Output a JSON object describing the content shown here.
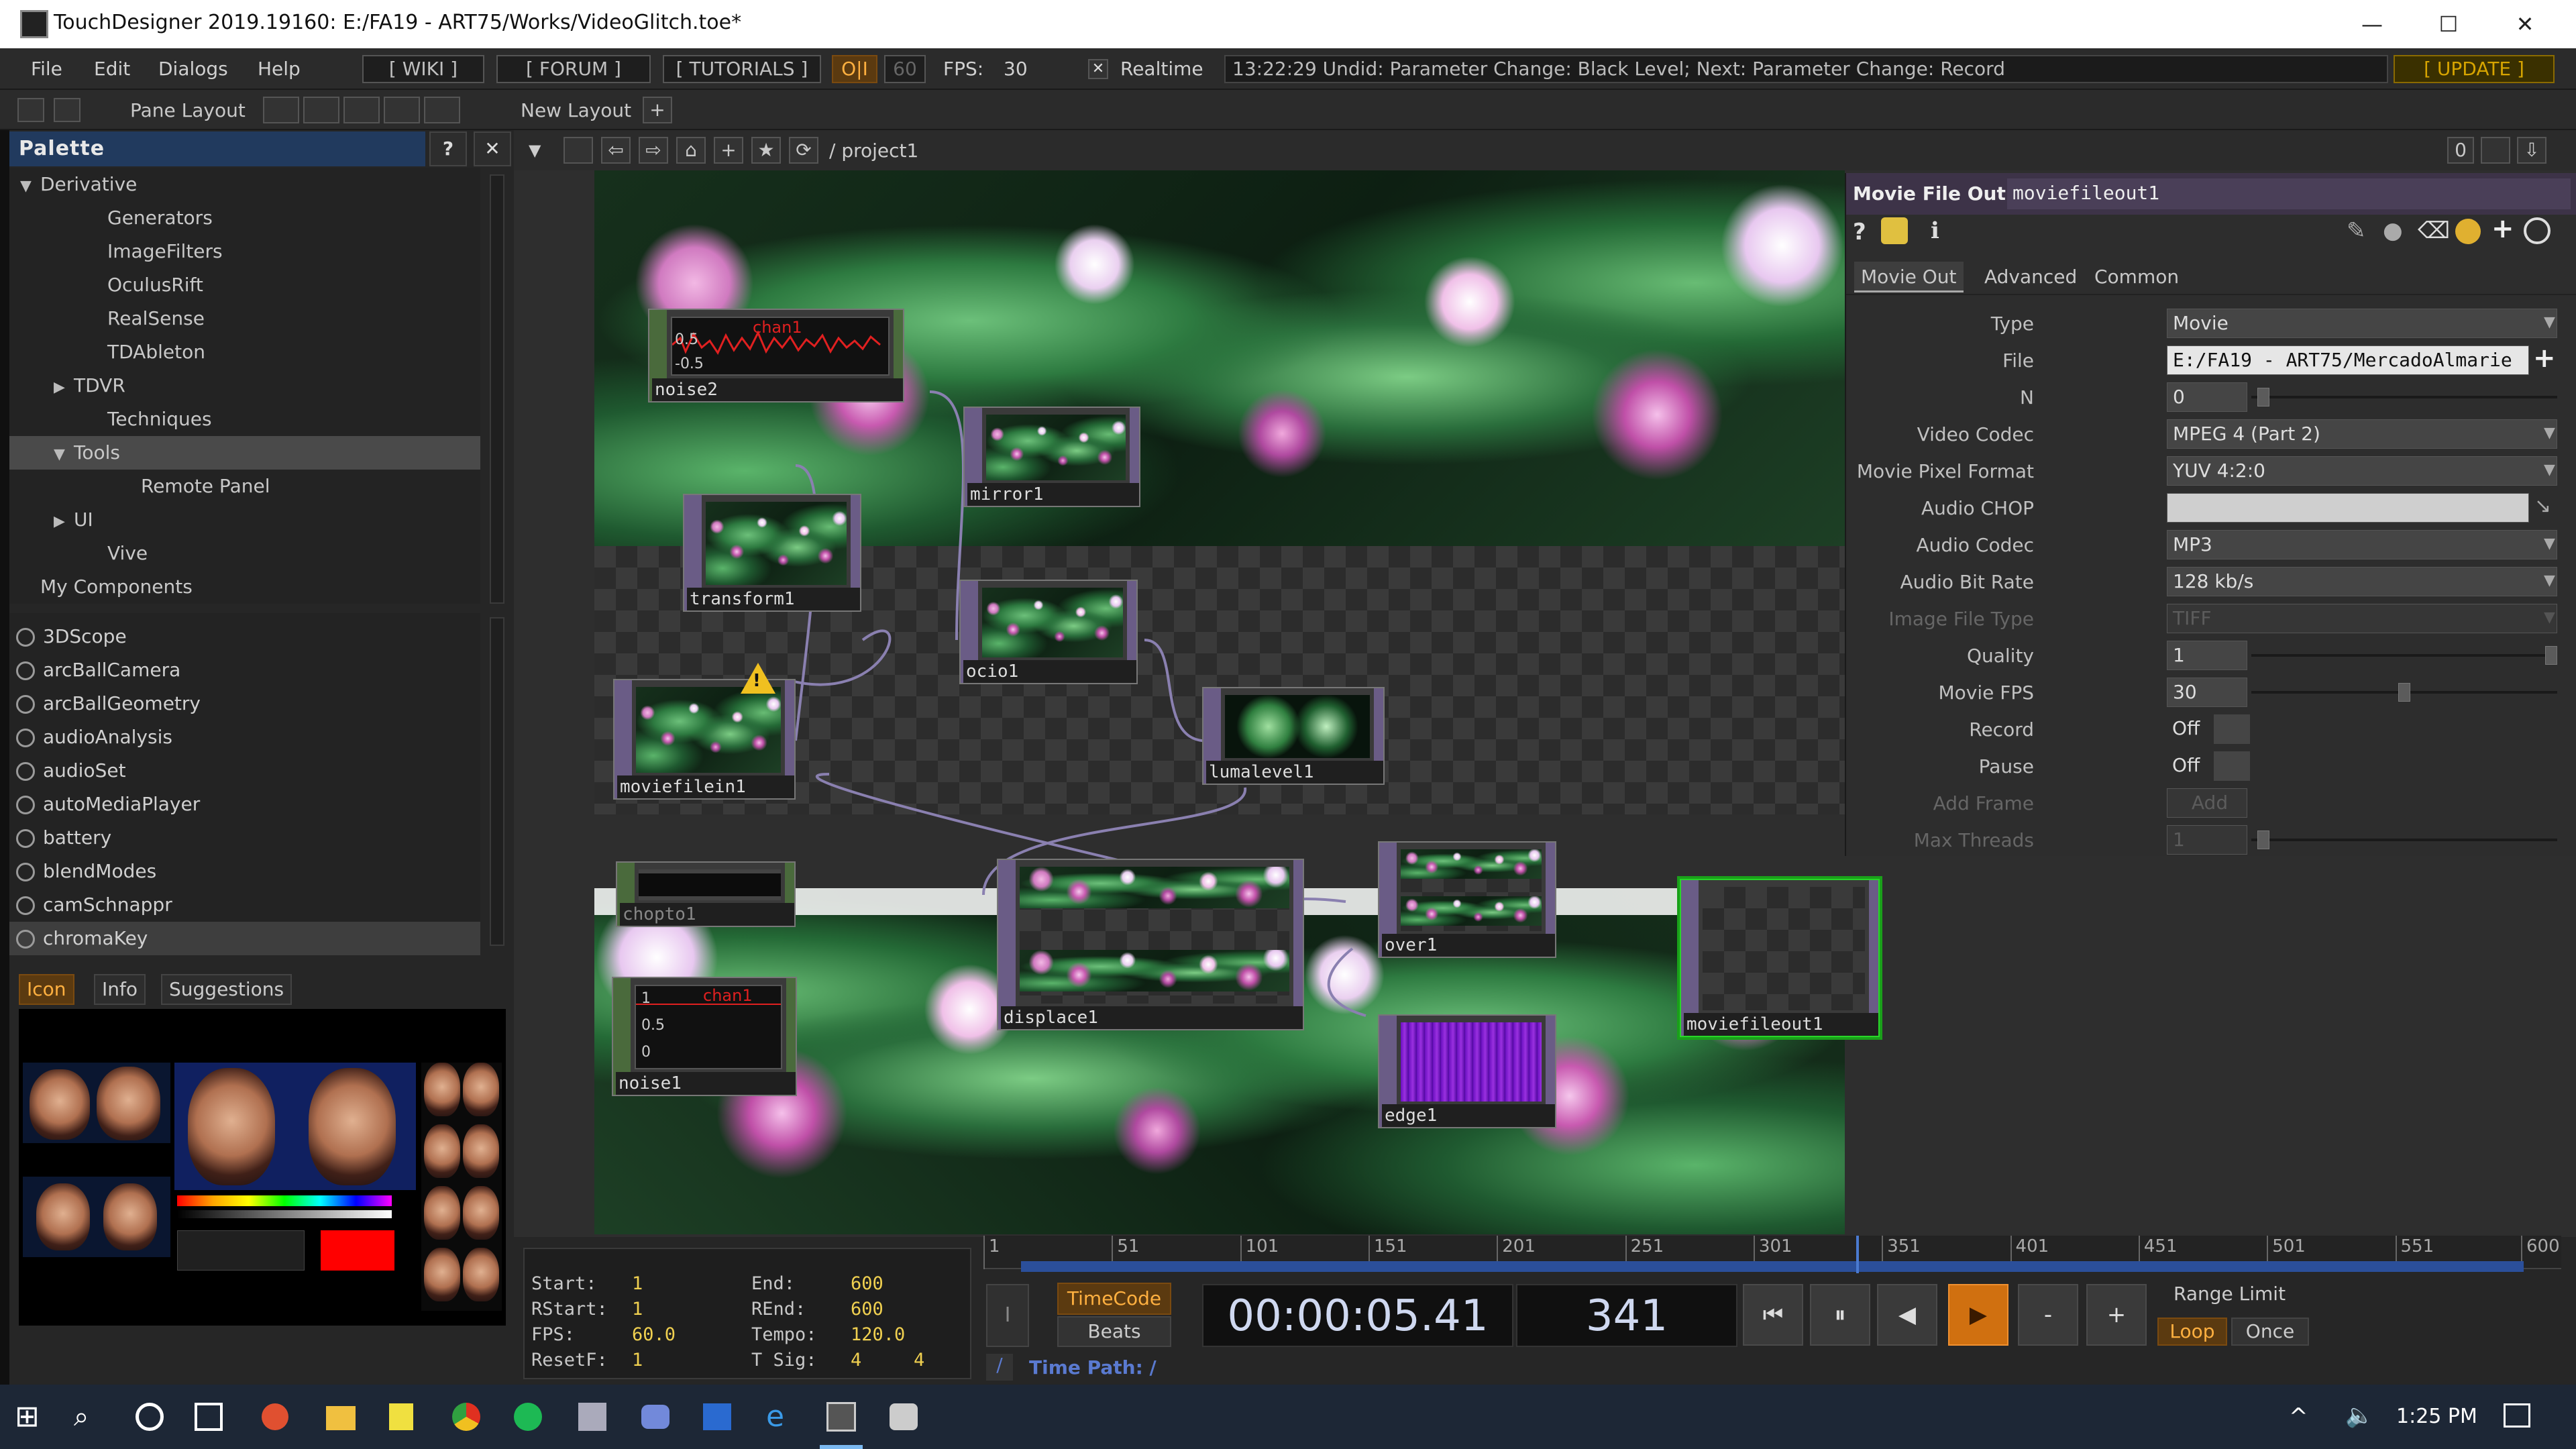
{
  "window": {
    "title": "TouchDesigner 2019.19160: E:/FA19 - ART75/Works/VideoGlitch.toe*",
    "minimize": "—",
    "maximize": "☐",
    "close": "✕"
  },
  "menubar": {
    "items": [
      "File",
      "Edit",
      "Dialogs",
      "Help"
    ],
    "wiki": "[ WIKI ]",
    "forum": "[ FORUM ]",
    "tutorials": "[ TUTORIALS ]",
    "oi": "O|I",
    "fps_target": "60",
    "fps_label": "FPS:",
    "fps_value": "30",
    "realtime": "Realtime",
    "status_message": "13:22:29 Undid: Parameter Change: Black Level; Next: Parameter Change: Record",
    "update": "[ UPDATE ]"
  },
  "toolbar": {
    "pane_layout": "Pane Layout",
    "new_layout": "New Layout",
    "add": "+"
  },
  "palette": {
    "title": "Palette",
    "help": "?",
    "close": "✕",
    "tree": [
      {
        "label": "Derivative",
        "level": 0,
        "arrow": "▼"
      },
      {
        "label": "Generators",
        "level": 2,
        "arrow": ""
      },
      {
        "label": "ImageFilters",
        "level": 2,
        "arrow": ""
      },
      {
        "label": "OculusRift",
        "level": 2,
        "arrow": ""
      },
      {
        "label": "RealSense",
        "level": 2,
        "arrow": ""
      },
      {
        "label": "TDAbleton",
        "level": 2,
        "arrow": ""
      },
      {
        "label": "TDVR",
        "level": 1,
        "arrow": "▶"
      },
      {
        "label": "Techniques",
        "level": 2,
        "arrow": ""
      },
      {
        "label": "Tools",
        "level": 1,
        "arrow": "▼",
        "selected": true
      },
      {
        "label": "Remote Panel",
        "level": 3,
        "arrow": ""
      },
      {
        "label": "UI",
        "level": 1,
        "arrow": "▶"
      },
      {
        "label": "Vive",
        "level": 2,
        "arrow": ""
      },
      {
        "label": "My Components",
        "level": 0,
        "arrow": ""
      }
    ],
    "components": [
      "3DScope",
      "arcBallCamera",
      "arcBallGeometry",
      "audioAnalysis",
      "audioSet",
      "autoMediaPlayer",
      "battery",
      "blendModes",
      "camSchnappr",
      "chromaKey"
    ],
    "selected_component": "chromaKey",
    "tabs": [
      "Icon",
      "Info",
      "Suggestions"
    ],
    "active_tab": "Icon"
  },
  "network": {
    "path": "/ project1",
    "right_counter": "0",
    "nodes": [
      {
        "name": "noise2",
        "chan_label": "chan1",
        "y_hi": "0.5",
        "y_lo": "-0.5"
      },
      {
        "name": "mirror1"
      },
      {
        "name": "transform1"
      },
      {
        "name": "ocio1"
      },
      {
        "name": "moviefilein1",
        "warning": "!"
      },
      {
        "name": "lumalevel1"
      },
      {
        "name": "chopto1"
      },
      {
        "name": "displace1"
      },
      {
        "name": "over1"
      },
      {
        "name": "edge1"
      },
      {
        "name": "moviefileout1"
      },
      {
        "name": "noise1",
        "chan_label": "chan1",
        "y_1": "1",
        "y_05": "0.5",
        "y_0": "0"
      }
    ]
  },
  "params": {
    "op_type": "Movie File Out",
    "op_name": "moviefileout1",
    "help": "?",
    "info": "i",
    "tabs": [
      "Movie Out",
      "Advanced",
      "Common"
    ],
    "active_tab": "Movie Out",
    "rows": [
      {
        "label": "Type",
        "value": "Movie",
        "kind": "menu",
        "dim": false
      },
      {
        "label": "File",
        "value": "E:/FA19 - ART75/MercadoAlmarie",
        "kind": "file",
        "dim": false
      },
      {
        "label": "N",
        "value": "0",
        "kind": "slider",
        "dim": false
      },
      {
        "label": "Video Codec",
        "value": "MPEG 4 (Part 2)",
        "kind": "menu",
        "dim": false
      },
      {
        "label": "Movie Pixel Format",
        "value": "YUV 4:2:0",
        "kind": "menu",
        "dim": false
      },
      {
        "label": "Audio CHOP",
        "value": "",
        "kind": "ref",
        "dim": false
      },
      {
        "label": "Audio Codec",
        "value": "MP3",
        "kind": "menu",
        "dim": false
      },
      {
        "label": "Audio Bit Rate",
        "value": "128 kb/s",
        "kind": "menu",
        "dim": false
      },
      {
        "label": "Image File Type",
        "value": "TIFF",
        "kind": "menu",
        "dim": true
      },
      {
        "label": "Quality",
        "value": "1",
        "kind": "slider",
        "dim": false
      },
      {
        "label": "Movie FPS",
        "value": "30",
        "kind": "slider",
        "dim": false
      },
      {
        "label": "Record",
        "value": "Off",
        "kind": "toggle",
        "dim": false
      },
      {
        "label": "Pause",
        "value": "Off",
        "kind": "toggle",
        "dim": false
      },
      {
        "label": "Add Frame",
        "value": "Add",
        "kind": "button",
        "dim": true
      },
      {
        "label": "Max Threads",
        "value": "1",
        "kind": "slider",
        "dim": true
      }
    ]
  },
  "timeline": {
    "info": {
      "start_k": "Start:",
      "start_v": "1",
      "end_k": "End:",
      "end_v": "600",
      "rstart_k": "RStart:",
      "rstart_v": "1",
      "rend_k": "REnd:",
      "rend_v": "600",
      "fps_k": "FPS:",
      "fps_v": "60.0",
      "tempo_k": "Tempo:",
      "tempo_v": "120.0",
      "resetf_k": "ResetF:",
      "resetf_v": "1",
      "tsig_k": "T Sig:",
      "tsig_a": "4",
      "tsig_b": "4"
    },
    "ruler_ticks": [
      "1",
      "51",
      "101",
      "151",
      "201",
      "251",
      "301",
      "351",
      "401",
      "451",
      "501",
      "551",
      "600"
    ],
    "current_frame": "341",
    "timecode_label": "TimeCode",
    "beats_label": "Beats",
    "timecode": "00:00:05.41",
    "frame": "341",
    "range_limit": "Range Limit",
    "loop": "Loop",
    "once": "Once",
    "time_path_label": "Time Path: /",
    "slash": "/",
    "minus": "-",
    "plus": "+"
  },
  "taskbar": {
    "time": "1:25 PM"
  },
  "colors": {
    "accent_orange": "#ffb040",
    "palette_header": "#213a5e",
    "param_header": "#3d3348",
    "selection_green": "#29d629",
    "timeline_bar": "#2b4f9a"
  }
}
